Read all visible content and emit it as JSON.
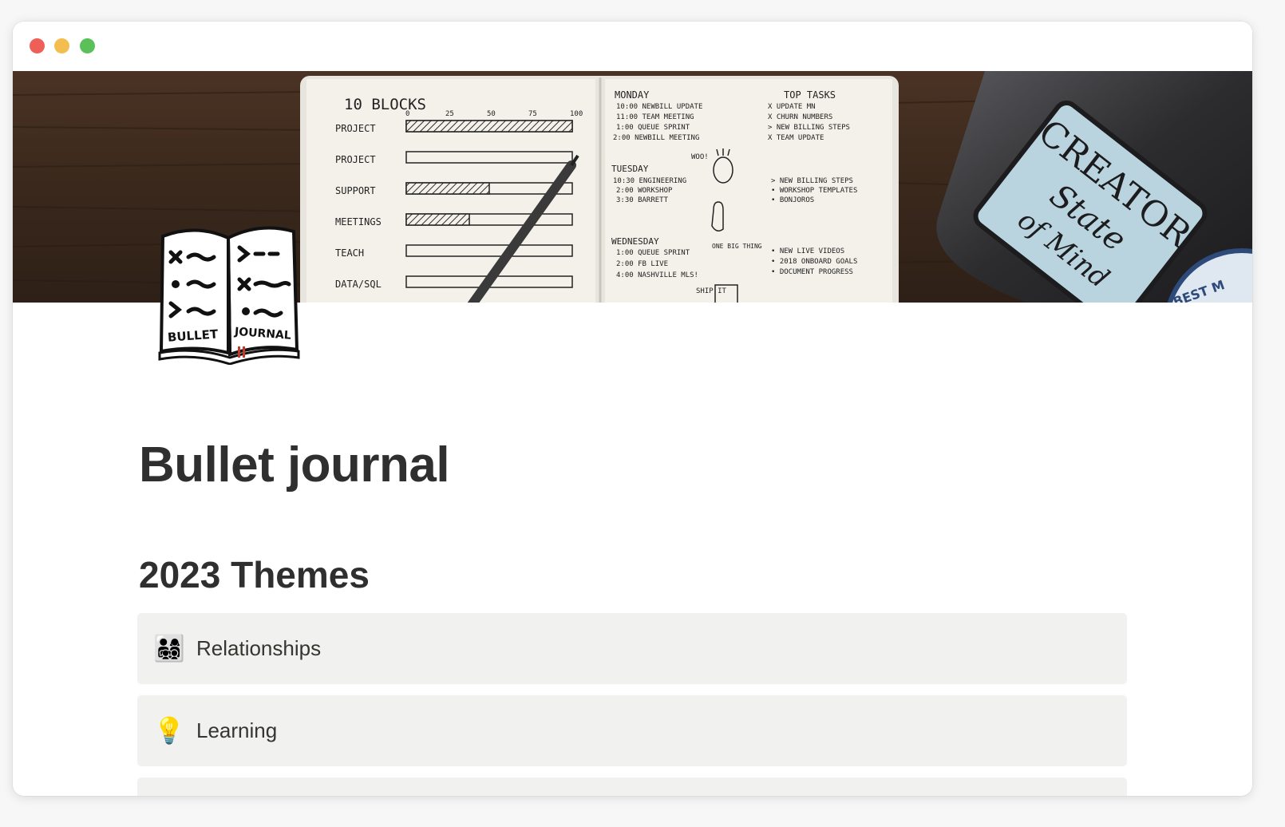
{
  "window": {
    "controls": [
      "close",
      "minimize",
      "zoom"
    ]
  },
  "cover": {
    "image": "bullet-journal-cover-photo",
    "notebook_left": {
      "heading": "10 BLOCKS",
      "scale": [
        "0",
        "25",
        "50",
        "75",
        "100"
      ],
      "rows": [
        "PROJECT",
        "PROJECT",
        "SUPPORT",
        "MEETINGS",
        "TEACH",
        "DATA/SQL"
      ],
      "progress": [
        1.0,
        0.0,
        0.5,
        0.38,
        0.0,
        0.0
      ]
    },
    "notebook_right": {
      "monday": "MONDAY",
      "monday_items": [
        "10:00 NEWBILL UPDATE",
        "11:00 TEAM MEETING",
        "1:00 QUEUE SPRINT",
        "2:00 NEWBILL MEETING"
      ],
      "tuesday": "TUESDAY",
      "tuesday_items": [
        "10:30 ENGINEERING",
        "2:00 WORKSHOP",
        "3:30 BARRETT"
      ],
      "wednesday": "WEDNESDAY",
      "wednesday_items": [
        "1:00 QUEUE SPRINT",
        "2:00 FB LIVE",
        "4:00 NASHVILLE MLS!"
      ],
      "top_tasks": "TOP TASKS",
      "top_task_items": [
        "X UPDATE MN",
        "X CHURN NUMBERS",
        "> NEW BILLING STEPS",
        "X TEAM UPDATE"
      ],
      "tasks_2": [
        "> NEW BILLING STEPS",
        "• WORKSHOP TEMPLATES",
        "• BONJOROS"
      ],
      "tasks_3": [
        "• NEW LIVE VIDEOS",
        "• 2018 ONBOARD GOALS",
        "• DOCUMENT PROGRESS"
      ],
      "doodle_text_1": "WOO!",
      "doodle_text_2": "ONE BIG THING",
      "doodle_text_3": "SHIP IT"
    },
    "laptop_sticker_lines": [
      "CREATOR",
      "State",
      "of Mind"
    ],
    "laptop_badge": "BEST M"
  },
  "page_icon": {
    "name": "bullet-journal-icon",
    "left_label": "BULLET",
    "right_label": "JOURNAL"
  },
  "page": {
    "title": "Bullet journal",
    "section_heading": "2023 Themes"
  },
  "themes": [
    {
      "emoji": "👨‍👩‍👧‍👦",
      "emoji_name": "family-icon",
      "label": "Relationships"
    },
    {
      "emoji": "💡",
      "emoji_name": "light-bulb-icon",
      "label": "Learning"
    },
    {
      "emoji": "",
      "emoji_name": "",
      "label": ""
    }
  ],
  "colors": {
    "card_bg": "#f1f1ef",
    "text": "#37352f",
    "title": "#2f2f2f",
    "desk": "#3d2a1e",
    "paper": "#f3f1ea",
    "laptop": "#2c2c2e",
    "sticker": "#b9d4de"
  }
}
